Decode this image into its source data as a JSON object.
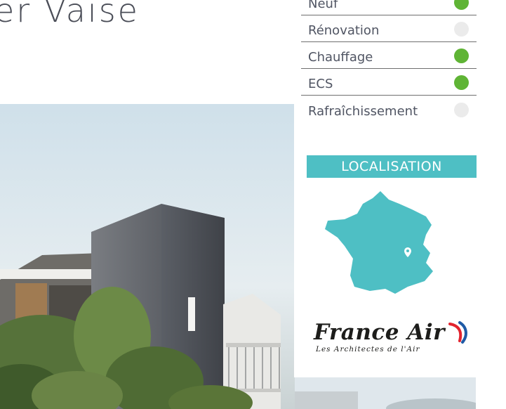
{
  "header": {
    "title_fragment": "er Vaise"
  },
  "criteria": [
    {
      "label": "Neuf",
      "active": true
    },
    {
      "label": "Rénovation",
      "active": false
    },
    {
      "label": "Chauffage",
      "active": true
    },
    {
      "label": "ECS",
      "active": true
    },
    {
      "label": "Rafraîchissement",
      "active": false
    }
  ],
  "localisation": {
    "heading": "LOCALISATION",
    "map_icon": "france-map",
    "marker_icon": "location-pin-icon"
  },
  "logo": {
    "name": "France Air",
    "tagline": "Les Architectes de l'Air"
  },
  "colors": {
    "accent": "#4ebfc4",
    "active_dot": "#5fb435",
    "inactive_dot": "#ebebeb",
    "text": "#505563"
  }
}
